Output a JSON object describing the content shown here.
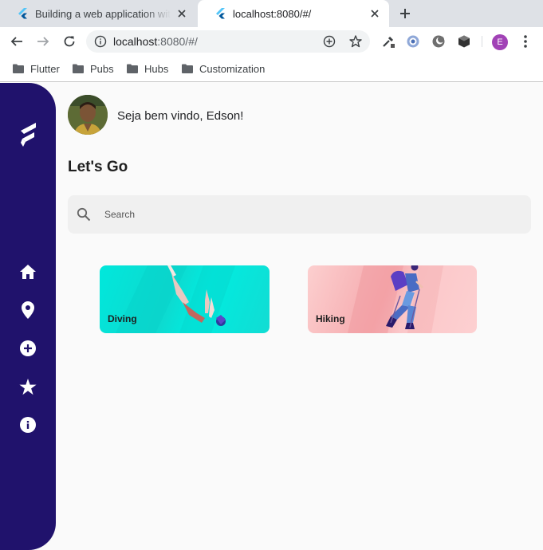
{
  "browser": {
    "tabs": [
      {
        "title": "Building a web application with Flutter",
        "active": false
      },
      {
        "title": "localhost:8080/#/",
        "active": true
      }
    ],
    "url_host": "localhost",
    "url_rest": ":8080/#/",
    "profile_initial": "E",
    "profile_color": "#a142b6",
    "bookmarks": [
      "Flutter",
      "Pubs",
      "Hubs",
      "Customization"
    ]
  },
  "app": {
    "sidebar_color": "#20126c",
    "nav_icons": [
      "home-icon",
      "location-pin-icon",
      "add-circle-icon",
      "star-icon",
      "info-icon"
    ],
    "welcome": "Seja bem vindo, Edson!",
    "heading": "Let's Go",
    "search": {
      "placeholder": "Search"
    },
    "categories": [
      {
        "label": "Diving",
        "color": "#00e8dc"
      },
      {
        "label": "Hiking",
        "color": "#fccfcf"
      }
    ]
  }
}
